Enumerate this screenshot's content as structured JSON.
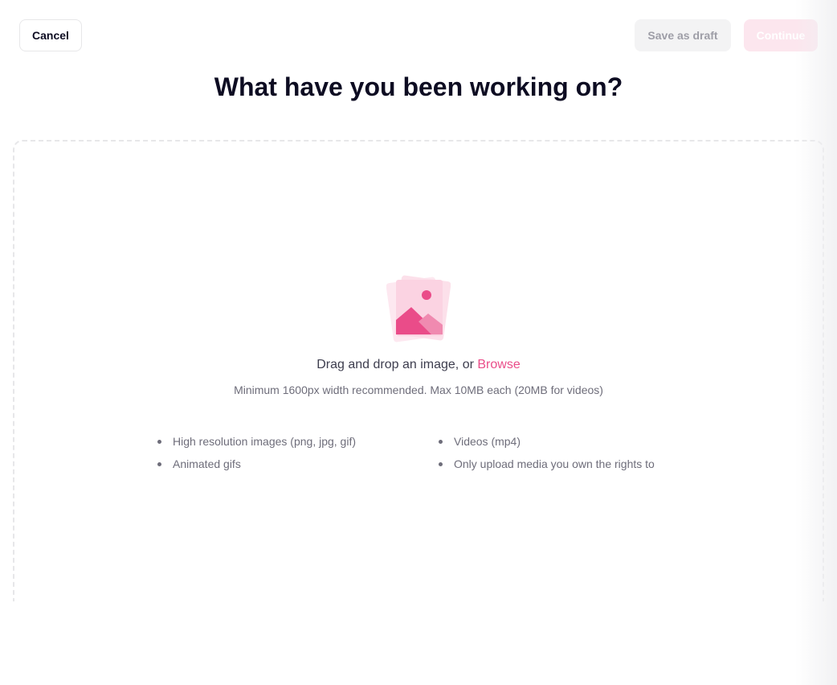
{
  "header": {
    "cancel_label": "Cancel",
    "save_draft_label": "Save as draft",
    "continue_label": "Continue"
  },
  "main": {
    "title": "What have you been working on?",
    "upload": {
      "icon": "image-upload-icon",
      "drag_text": "Drag and drop an image, or ",
      "browse_label": "Browse",
      "hint": "Minimum 1600px width recommended. Max 10MB each (20MB for videos)",
      "requirements_left": [
        "High resolution images (png, jpg, gif)",
        "Animated gifs"
      ],
      "requirements_right": [
        "Videos (mp4)",
        "Only upload media you own the rights to"
      ]
    }
  },
  "colors": {
    "accent": "#ea4c89",
    "accent_light": "#fce6ee",
    "text_primary": "#0d0c22",
    "text_secondary": "#6e6d7a"
  }
}
